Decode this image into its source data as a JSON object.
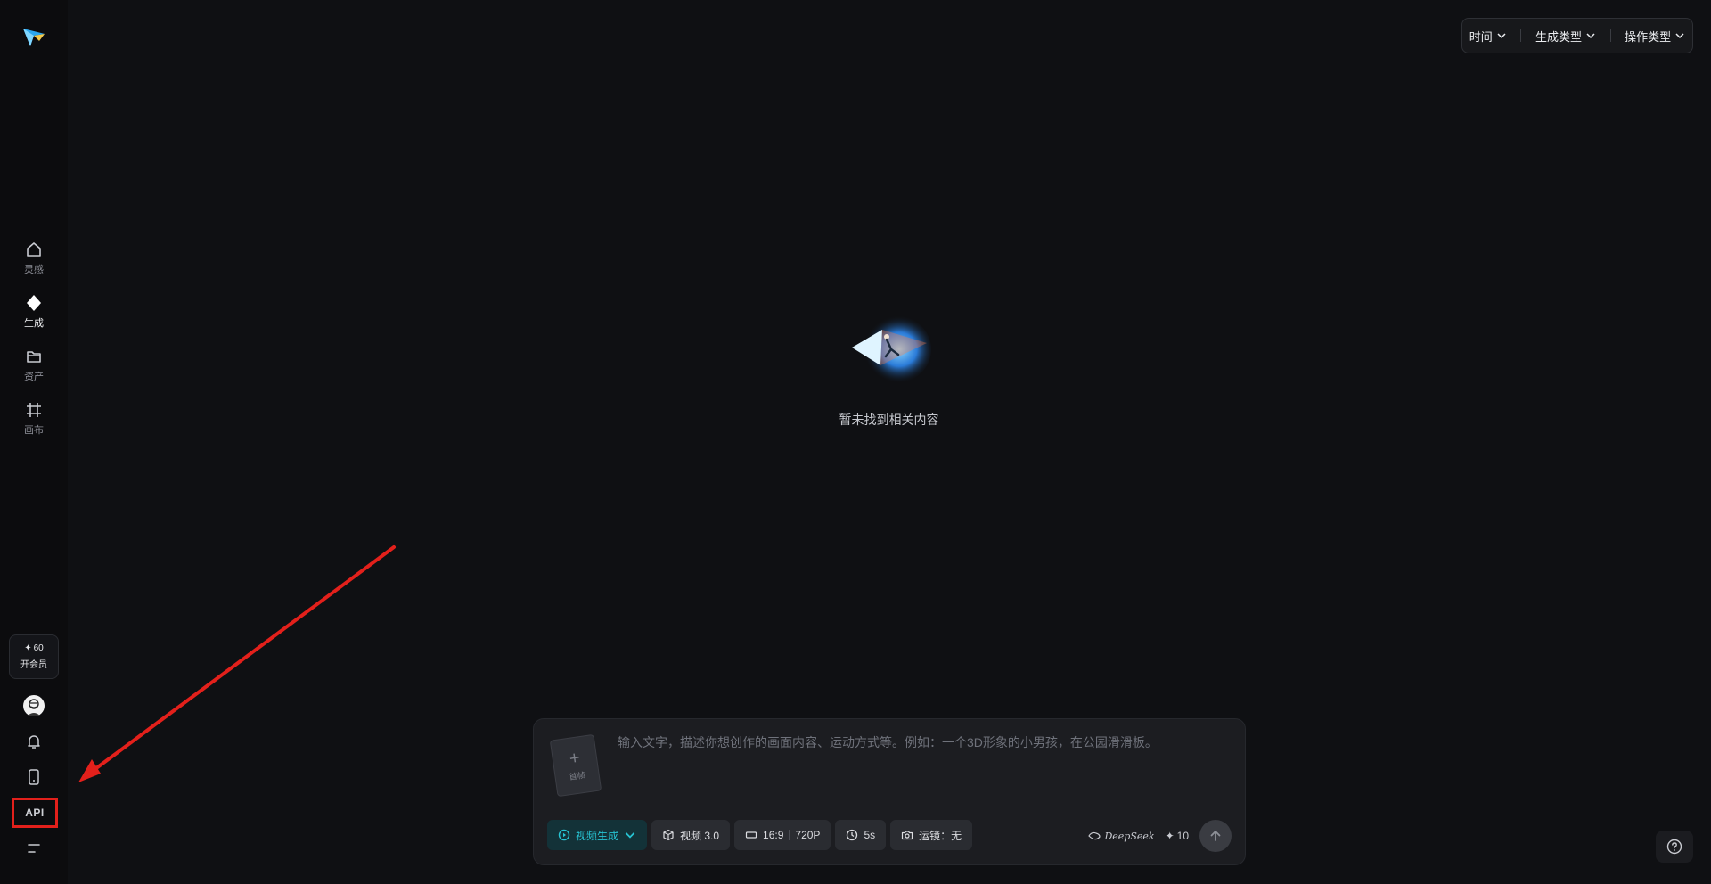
{
  "sidebar": {
    "nav": [
      {
        "label": "灵感",
        "icon": "home-icon"
      },
      {
        "label": "生成",
        "icon": "sparkle-icon"
      },
      {
        "label": "资产",
        "icon": "folder-icon"
      },
      {
        "label": "画布",
        "icon": "crop-grid-icon"
      }
    ],
    "vip": {
      "credits": "60",
      "label": "开会员"
    },
    "api_label": "API"
  },
  "filters": [
    {
      "label": "时间"
    },
    {
      "label": "生成类型"
    },
    {
      "label": "操作类型"
    }
  ],
  "empty_state": {
    "text": "暂未找到相关内容"
  },
  "composer": {
    "first_frame_label": "首帧",
    "placeholder": "输入文字，描述你想创作的画面内容、运动方式等。例如：一个3D形象的小男孩，在公园滑滑板。",
    "mode": "视频生成",
    "model": "视频 3.0",
    "ratio": "16:9",
    "resolution": "720P",
    "duration": "5s",
    "camera": "运镜：无",
    "deepseek": "DeepSeek",
    "cost": "10"
  },
  "colors": {
    "accent": "#27c3d2",
    "annotation": "#e3201b",
    "background": "#0f1013"
  }
}
